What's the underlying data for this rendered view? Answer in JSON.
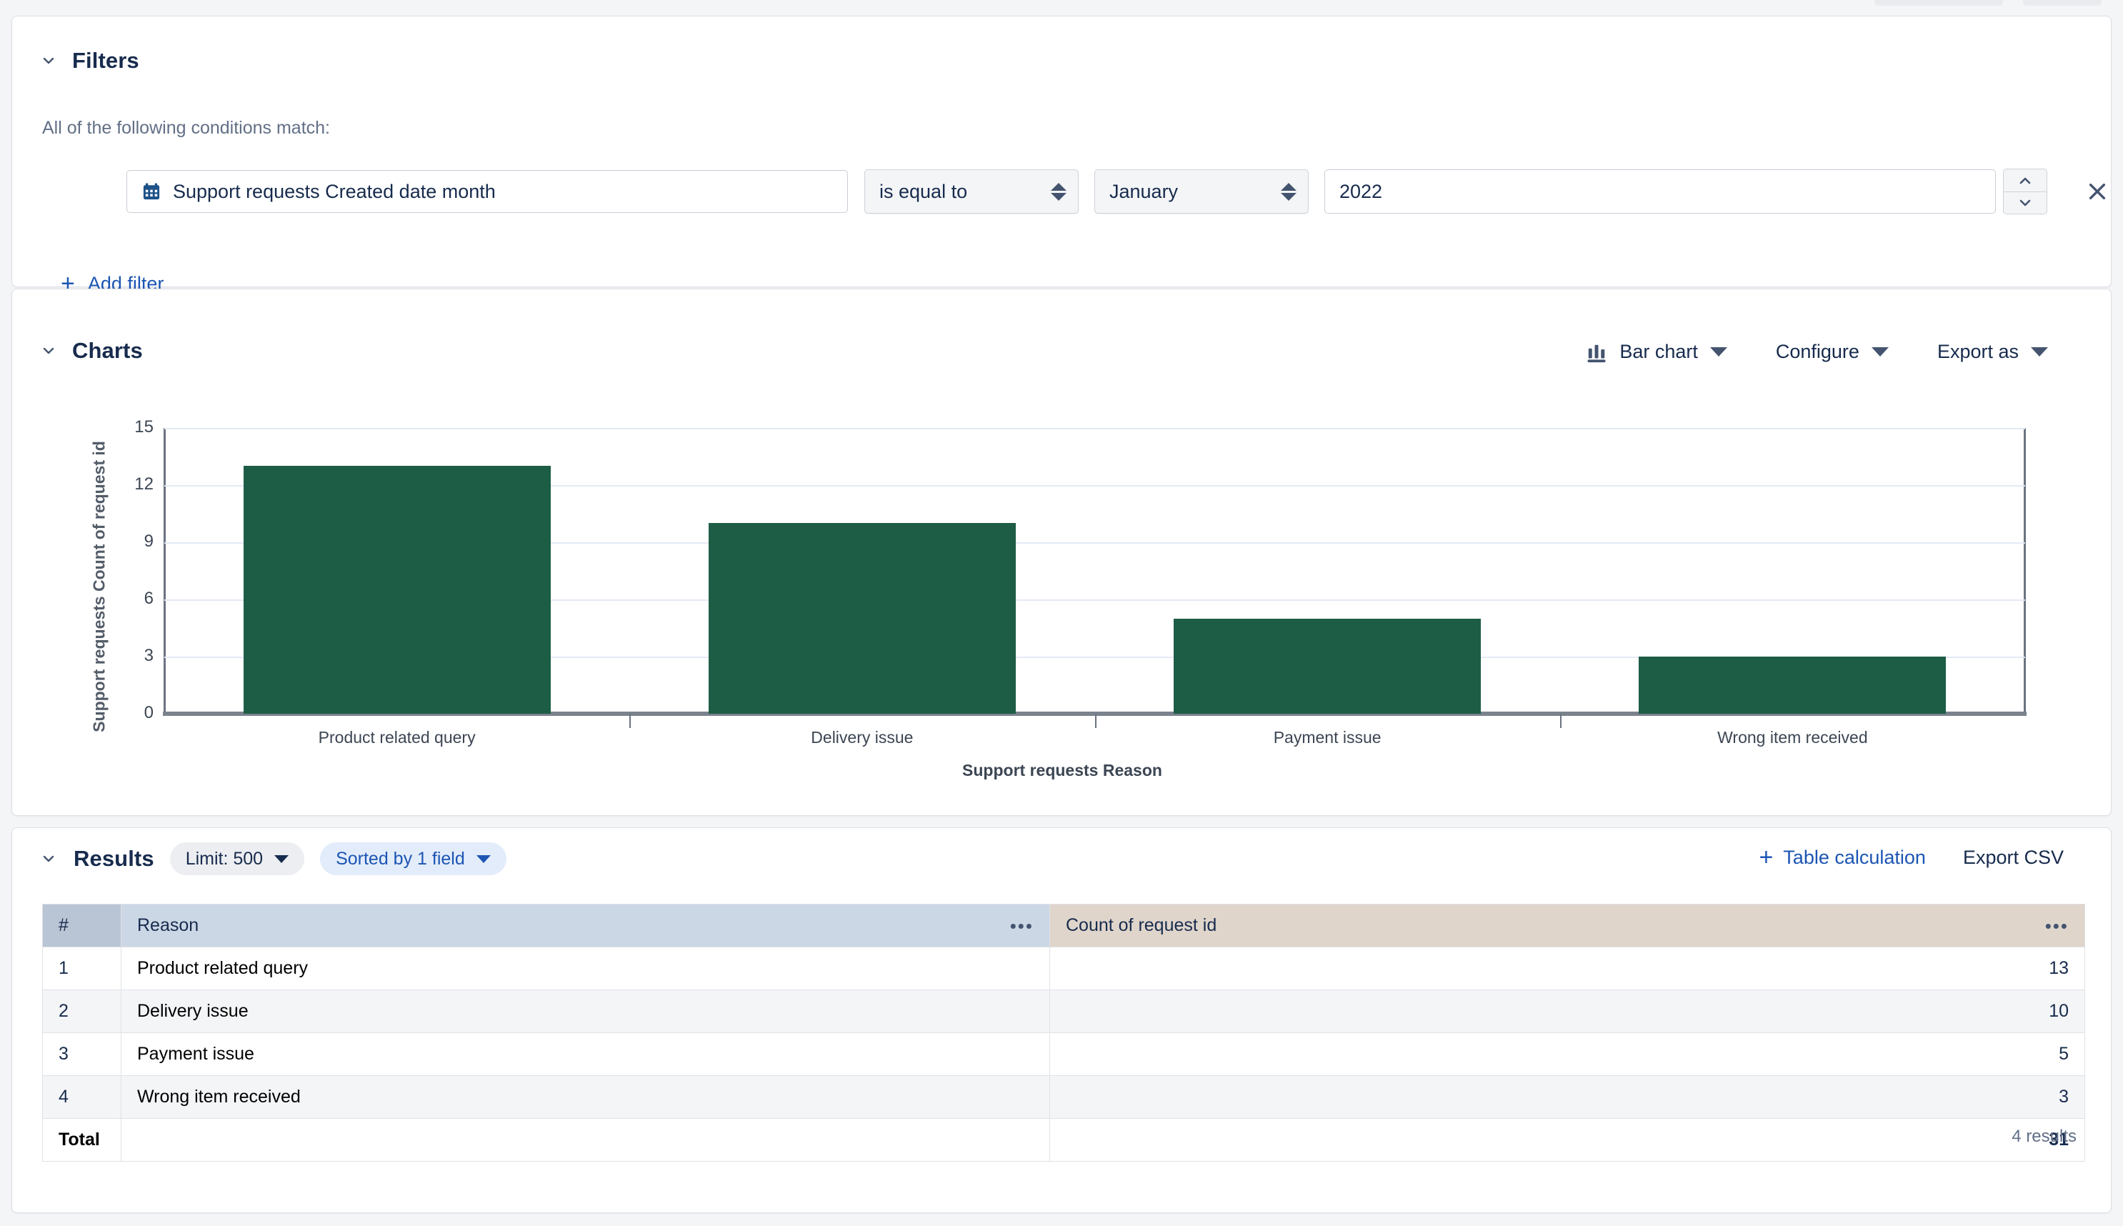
{
  "filters": {
    "title": "Filters",
    "conditions_label": "All of the following conditions match:",
    "field_icon": "calendar-icon",
    "field": "Support requests Created date month",
    "operator": "is equal to",
    "month": "January",
    "year": "2022",
    "add_filter_label": "Add filter",
    "remove_icon": "close-icon"
  },
  "charts": {
    "title": "Charts",
    "chart_type_label": "Bar chart",
    "chart_type_icon": "bar-chart-icon",
    "configure_label": "Configure",
    "export_as_label": "Export as"
  },
  "chart_data": {
    "type": "bar",
    "title": "",
    "categories": [
      "Product related query",
      "Delivery issue",
      "Payment issue",
      "Wrong item received"
    ],
    "values": [
      13,
      10,
      5,
      3
    ],
    "xlabel": "Support requests Reason",
    "ylabel": "Support requests Count of request id",
    "yticks": [
      0,
      3,
      6,
      9,
      12,
      15
    ],
    "ylim": [
      0,
      15
    ],
    "grid": true,
    "legend": "none",
    "bar_color": "#1d5d46",
    "gridline_color": "#e4e9f5"
  },
  "results": {
    "title": "Results",
    "limit_label": "Limit: 500",
    "sorted_label": "Sorted by 1 field",
    "table_calculation_label": "Table calculation",
    "export_csv_label": "Export CSV",
    "overflow_icon": "ellipsis-icon",
    "columns": [
      "#",
      "Reason",
      "Count of request id"
    ],
    "rows": [
      {
        "num": "1",
        "reason": "Product related query",
        "count": "13"
      },
      {
        "num": "2",
        "reason": "Delivery issue",
        "count": "10"
      },
      {
        "num": "3",
        "reason": "Payment issue",
        "count": "5"
      },
      {
        "num": "4",
        "reason": "Wrong item received",
        "count": "3"
      }
    ],
    "total_label": "Total",
    "total_value": "31",
    "results_count": "4 results"
  }
}
